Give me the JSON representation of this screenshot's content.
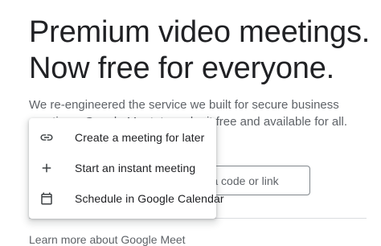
{
  "hero": {
    "headline_line1": "Premium video meetings.",
    "headline_line2": "Now free for everyone.",
    "subtext_line1": "We re-engineered the service we built for secure business",
    "subtext_line2": "meetings, Google Meet, to make it free and available for all."
  },
  "join": {
    "placeholder": "Enter a code or link"
  },
  "menu": {
    "items": [
      {
        "label": "Create a meeting for later",
        "icon": "link-icon"
      },
      {
        "label": "Start an instant meeting",
        "icon": "plus-icon"
      },
      {
        "label": "Schedule in Google Calendar",
        "icon": "calendar-icon"
      }
    ]
  },
  "footer": {
    "text": "Learn more about Google Meet"
  },
  "colors": {
    "text_primary": "#202124",
    "text_secondary": "#5f6368",
    "border": "#80868b",
    "divider": "#dadce0"
  }
}
